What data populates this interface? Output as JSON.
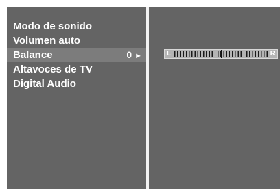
{
  "menu": {
    "items": [
      {
        "label": "Modo de sonido"
      },
      {
        "label": "Volumen auto"
      },
      {
        "label": "Balance",
        "value": "0",
        "arrow": "►",
        "selected": true
      },
      {
        "label": "Altavoces de TV"
      },
      {
        "label": "Digital Audio"
      }
    ]
  },
  "balance": {
    "left_label": "L",
    "right_label": "R",
    "value": 0,
    "min": -50,
    "max": 50
  },
  "colors": {
    "panel": "#646464",
    "selected_row": "#7c7c7c",
    "divider": "#f2f2f2",
    "text": "#ffffff"
  }
}
